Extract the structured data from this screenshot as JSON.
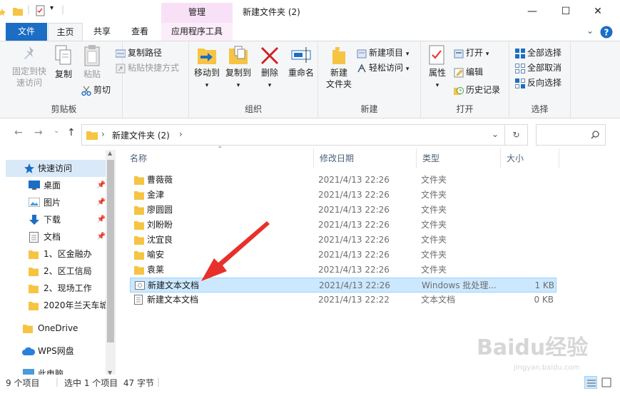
{
  "window": {
    "title": "新建文件夹 (2)",
    "context_tab": "管理",
    "minimize": "—",
    "maximize": "☐",
    "close": "✕"
  },
  "ribbon_tabs": {
    "file": "文件",
    "home": "主页",
    "share": "共享",
    "view": "查看",
    "app_tools": "应用程序工具"
  },
  "ribbon": {
    "clipboard": {
      "label": "剪贴板",
      "pin": "固定到快\n速访问",
      "copy": "复制",
      "paste": "粘贴",
      "copy_path": "复制路径",
      "paste_shortcut": "粘贴快捷方式",
      "cut": "剪切"
    },
    "organize": {
      "label": "组织",
      "move_to": "移动到",
      "copy_to": "复制到",
      "delete": "删除",
      "rename": "重命名"
    },
    "new": {
      "label": "新建",
      "new_folder": "新建\n文件夹",
      "new_item": "新建项目",
      "easy_access": "轻松访问"
    },
    "open": {
      "label": "打开",
      "properties": "属性",
      "open": "打开",
      "edit": "编辑",
      "history": "历史记录"
    },
    "select": {
      "label": "选择",
      "select_all": "全部选择",
      "select_none": "全部取消",
      "invert": "反向选择"
    }
  },
  "address": {
    "path": "新建文件夹 (2)",
    "separator": "›"
  },
  "nav": {
    "quick_access": "快速访问",
    "items": [
      {
        "label": "桌面",
        "pinned": true
      },
      {
        "label": "图片",
        "pinned": true
      },
      {
        "label": "下载",
        "pinned": true
      },
      {
        "label": "文档",
        "pinned": true
      },
      {
        "label": "1、区金融办",
        "pinned": false
      },
      {
        "label": "2、区工信局",
        "pinned": false
      },
      {
        "label": "2、现场工作",
        "pinned": false
      },
      {
        "label": "2020年兰天车城",
        "pinned": false
      }
    ],
    "onedrive": "OneDrive",
    "wps": "WPS网盘",
    "this_pc": "此电脑"
  },
  "columns": {
    "name": "名称",
    "modified": "修改日期",
    "type": "类型",
    "size": "大小"
  },
  "files": [
    {
      "name": "曹薇薇",
      "modified": "2021/4/13 22:26",
      "type": "文件夹",
      "size": "",
      "kind": "folder"
    },
    {
      "name": "金津",
      "modified": "2021/4/13 22:26",
      "type": "文件夹",
      "size": "",
      "kind": "folder"
    },
    {
      "name": "廖圆圆",
      "modified": "2021/4/13 22:26",
      "type": "文件夹",
      "size": "",
      "kind": "folder"
    },
    {
      "name": "刘盼盼",
      "modified": "2021/4/13 22:26",
      "type": "文件夹",
      "size": "",
      "kind": "folder"
    },
    {
      "name": "沈宜良",
      "modified": "2021/4/13 22:26",
      "type": "文件夹",
      "size": "",
      "kind": "folder"
    },
    {
      "name": "喻安",
      "modified": "2021/4/13 22:26",
      "type": "文件夹",
      "size": "",
      "kind": "folder"
    },
    {
      "name": "袁莱",
      "modified": "2021/4/13 22:26",
      "type": "文件夹",
      "size": "",
      "kind": "folder"
    },
    {
      "name": "新建文本文档",
      "modified": "2021/4/13 22:26",
      "type": "Windows 批处理...",
      "size": "1 KB",
      "kind": "bat",
      "selected": true
    },
    {
      "name": "新建文本文档",
      "modified": "2021/4/13 22:22",
      "type": "文本文档",
      "size": "0 KB",
      "kind": "txt"
    }
  ],
  "status": {
    "count": "9 个项目",
    "selected": "选中 1 个项目  47 字节"
  },
  "watermark": {
    "brand": "Baidu经验",
    "url": "jingyan.baidu.com"
  },
  "colors": {
    "accent": "#1c6dc4",
    "selection": "#cce8ff",
    "folder": "#f6c443",
    "arrow": "#e8302a",
    "context_tab": "#f8e1f6"
  }
}
